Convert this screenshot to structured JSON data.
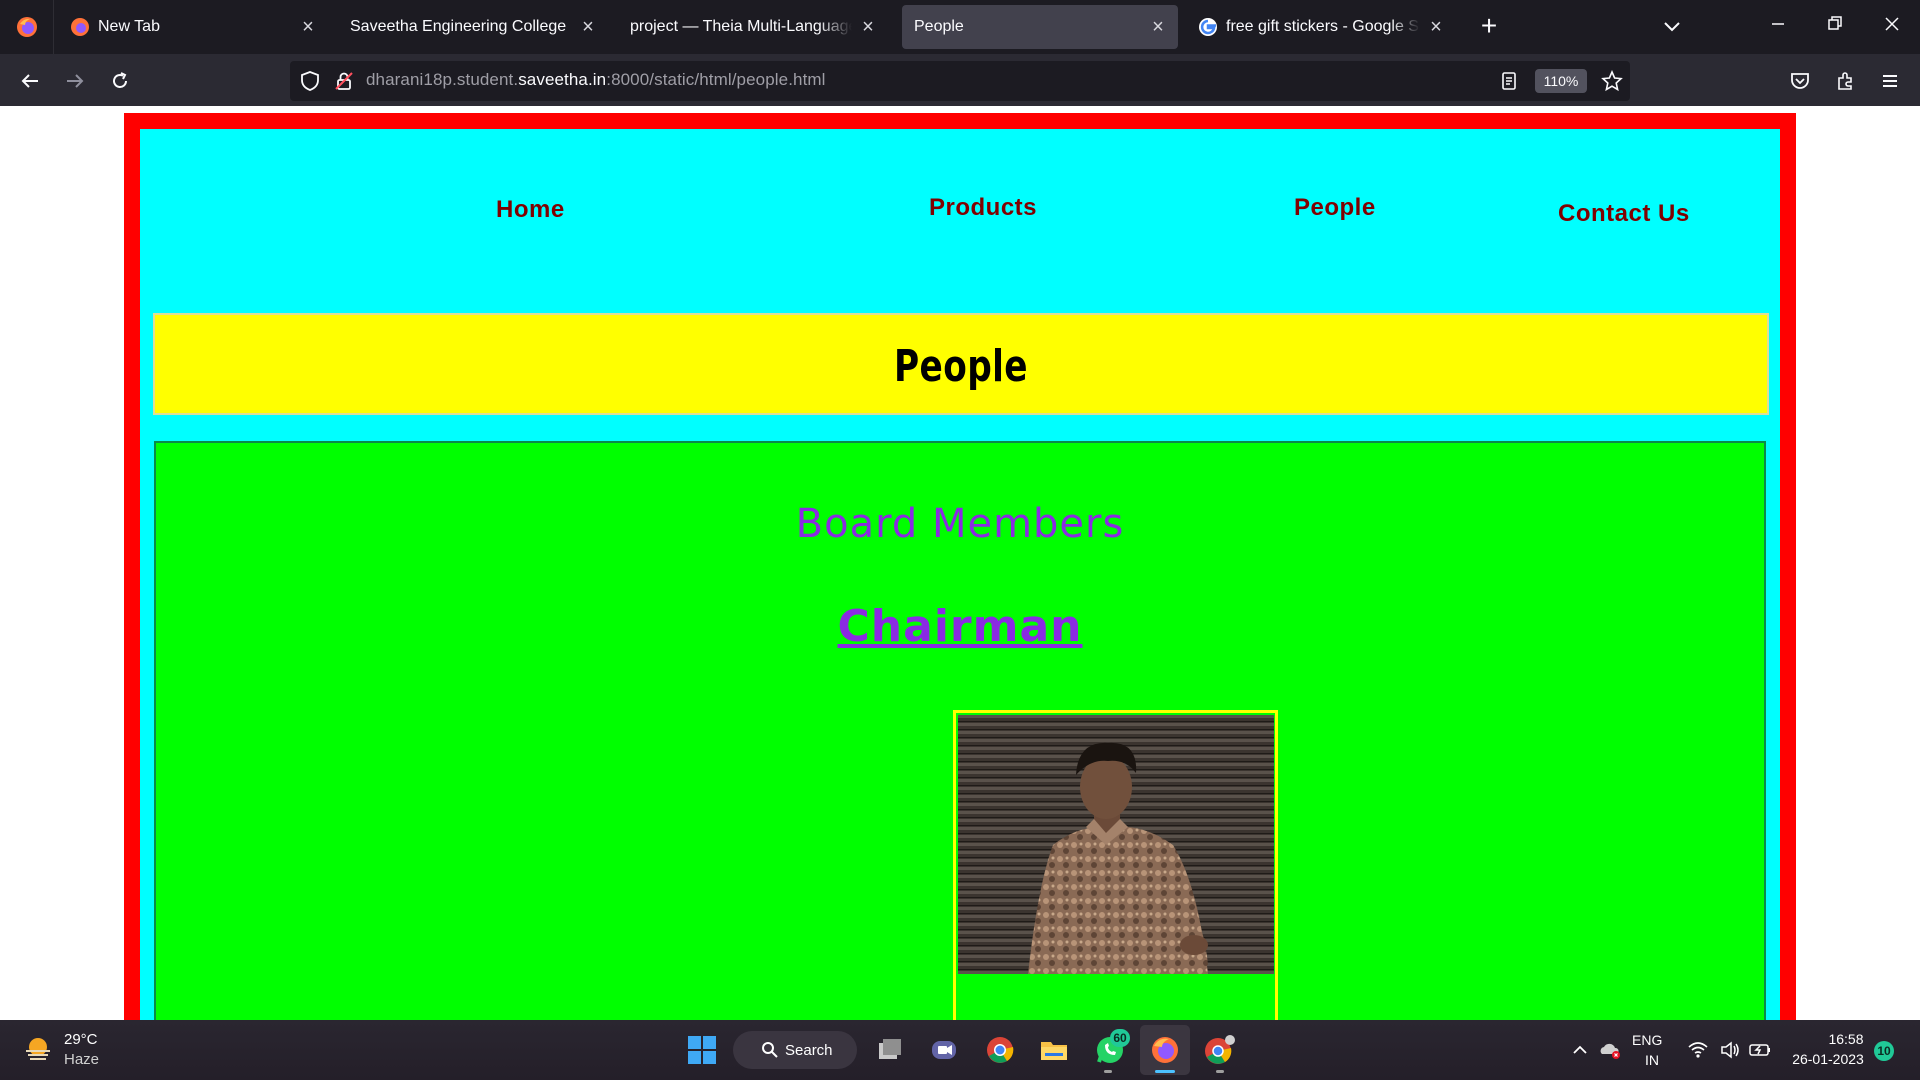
{
  "browser": {
    "tabs": [
      {
        "title": "New Tab",
        "active": false
      },
      {
        "title": "Saveetha Engineering College",
        "active": false
      },
      {
        "title": "project — Theia Multi-Language Explorer",
        "active": false
      },
      {
        "title": "People",
        "active": true
      },
      {
        "title": "free gift stickers - Google Search",
        "active": false
      }
    ],
    "url_prefix": "dharani18p.student.",
    "url_host": "saveetha.in",
    "url_suffix": ":8000/static/html/people.html",
    "zoom": "110%"
  },
  "site": {
    "nav": {
      "home": "Home",
      "products": "Products",
      "people": "People",
      "contact": "Contact Us"
    },
    "banner_title": "People",
    "section_title": "Board Members",
    "chairman_label": "Chairman"
  },
  "taskbar": {
    "temperature": "29°C",
    "weather": "Haze",
    "search_label": "Search",
    "whatsapp_badge": "60",
    "lang_top": "ENG",
    "lang_bottom": "IN",
    "time": "16:58",
    "date": "26-01-2023",
    "notification_count": "10"
  },
  "colors": {
    "frame": "#ff0000",
    "background": "#00ffff",
    "banner": "#ffff00",
    "content": "#00ff00",
    "nav_text": "#800000",
    "accent_text": "#8a2be2"
  }
}
